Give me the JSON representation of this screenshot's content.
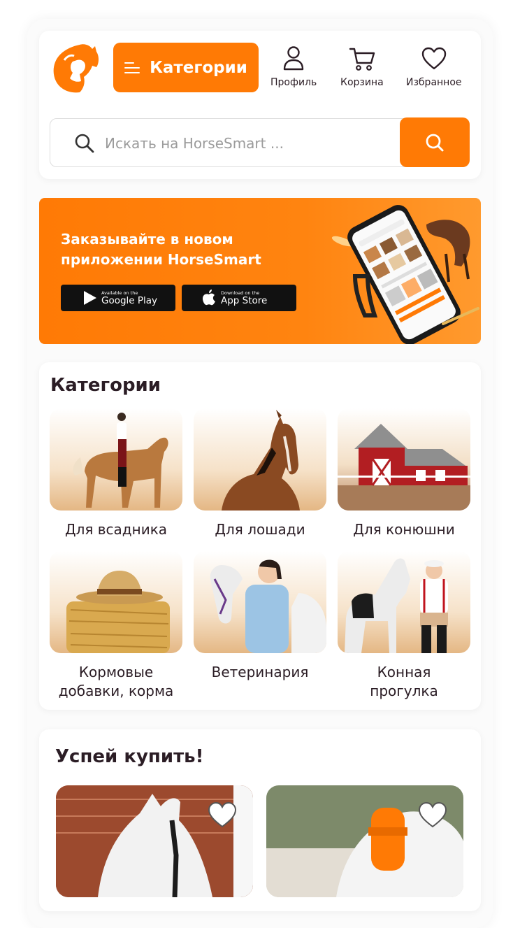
{
  "header": {
    "categories_button": "Категории",
    "nav": [
      {
        "label": "Профиль",
        "icon": "profile-icon"
      },
      {
        "label": "Корзина",
        "icon": "cart-icon"
      },
      {
        "label": "Избранное",
        "icon": "heart-icon"
      }
    ]
  },
  "search": {
    "placeholder": "Искать на HorseSmart ..."
  },
  "banner": {
    "title_line1": "Заказывайте в новом",
    "title_line2": "приложении HorseSmart",
    "google_small": "Available on the",
    "google_big": "Google Play",
    "apple_small": "Download on the",
    "apple_big": "App Store"
  },
  "categories": {
    "title": "Категории",
    "items": [
      {
        "line1": "Для всадника",
        "line2": ""
      },
      {
        "line1": "Для лошади",
        "line2": ""
      },
      {
        "line1": "Для конюшни",
        "line2": ""
      },
      {
        "line1": "Кормовые",
        "line2": "добавки, корма"
      },
      {
        "line1": "Ветеринария",
        "line2": ""
      },
      {
        "line1": "Конная",
        "line2": "прогулка"
      }
    ]
  },
  "deals": {
    "title": "Успей купить!"
  },
  "colors": {
    "accent": "#ff7a05",
    "text": "#2b1d25"
  }
}
